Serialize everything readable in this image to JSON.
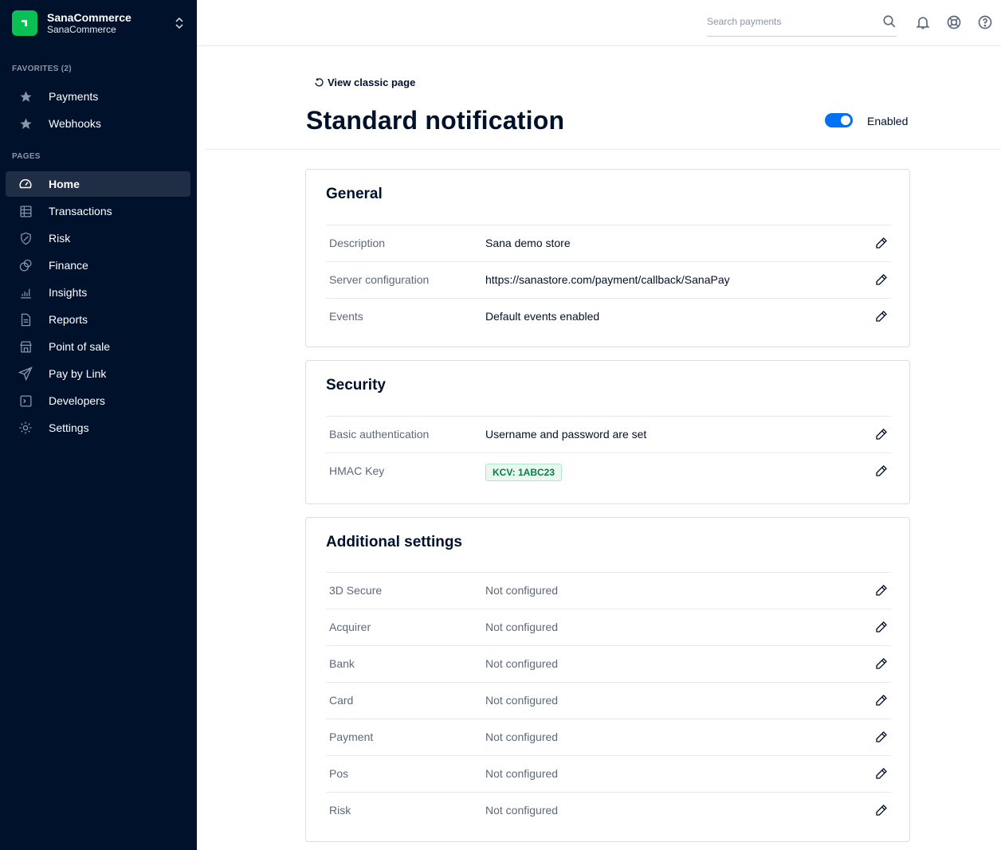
{
  "sidebar": {
    "account_name": "SanaCommerce",
    "account_sub": "SanaCommerce",
    "favorites_label": "FAVORITES (2)",
    "favorites": [
      {
        "label": "Payments",
        "icon": "star-icon"
      },
      {
        "label": "Webhooks",
        "icon": "star-icon"
      }
    ],
    "pages_label": "PAGES",
    "pages": [
      {
        "label": "Home",
        "icon": "home-gauge-icon",
        "active": true
      },
      {
        "label": "Transactions",
        "icon": "table-icon"
      },
      {
        "label": "Risk",
        "icon": "shield-icon"
      },
      {
        "label": "Finance",
        "icon": "coins-icon"
      },
      {
        "label": "Insights",
        "icon": "bar-chart-icon"
      },
      {
        "label": "Reports",
        "icon": "document-icon"
      },
      {
        "label": "Point of sale",
        "icon": "store-icon"
      },
      {
        "label": "Pay by Link",
        "icon": "send-icon"
      },
      {
        "label": "Developers",
        "icon": "terminal-icon"
      },
      {
        "label": "Settings",
        "icon": "gear-icon"
      }
    ]
  },
  "topbar": {
    "search_placeholder": "Search payments"
  },
  "header": {
    "classic_link": "View classic page",
    "title": "Standard notification",
    "toggle_label": "Enabled",
    "toggle_on": true
  },
  "sections": {
    "general": {
      "title": "General",
      "rows": [
        {
          "label": "Description",
          "value": "Sana demo store"
        },
        {
          "label": "Server configuration",
          "value": "https://sanastore.com/payment/callback/SanaPay"
        },
        {
          "label": "Events",
          "value": "Default events enabled"
        }
      ]
    },
    "security": {
      "title": "Security",
      "rows": [
        {
          "label": "Basic authentication",
          "value": "Username and password are set"
        },
        {
          "label": "HMAC Key",
          "value": "KCV: 1ABC23"
        }
      ]
    },
    "additional": {
      "title": "Additional settings",
      "rows": [
        {
          "label": "3D Secure",
          "value": "Not configured"
        },
        {
          "label": "Acquirer",
          "value": "Not configured"
        },
        {
          "label": "Bank",
          "value": "Not configured"
        },
        {
          "label": "Card",
          "value": "Not configured"
        },
        {
          "label": "Payment",
          "value": "Not configured"
        },
        {
          "label": "Pos",
          "value": "Not configured"
        },
        {
          "label": "Risk",
          "value": "Not configured"
        }
      ]
    }
  },
  "colors": {
    "sidebar_bg": "#00112c",
    "brand_green": "#0abf53",
    "toggle_blue": "#0070f5",
    "badge_green": "#0a7b45"
  }
}
